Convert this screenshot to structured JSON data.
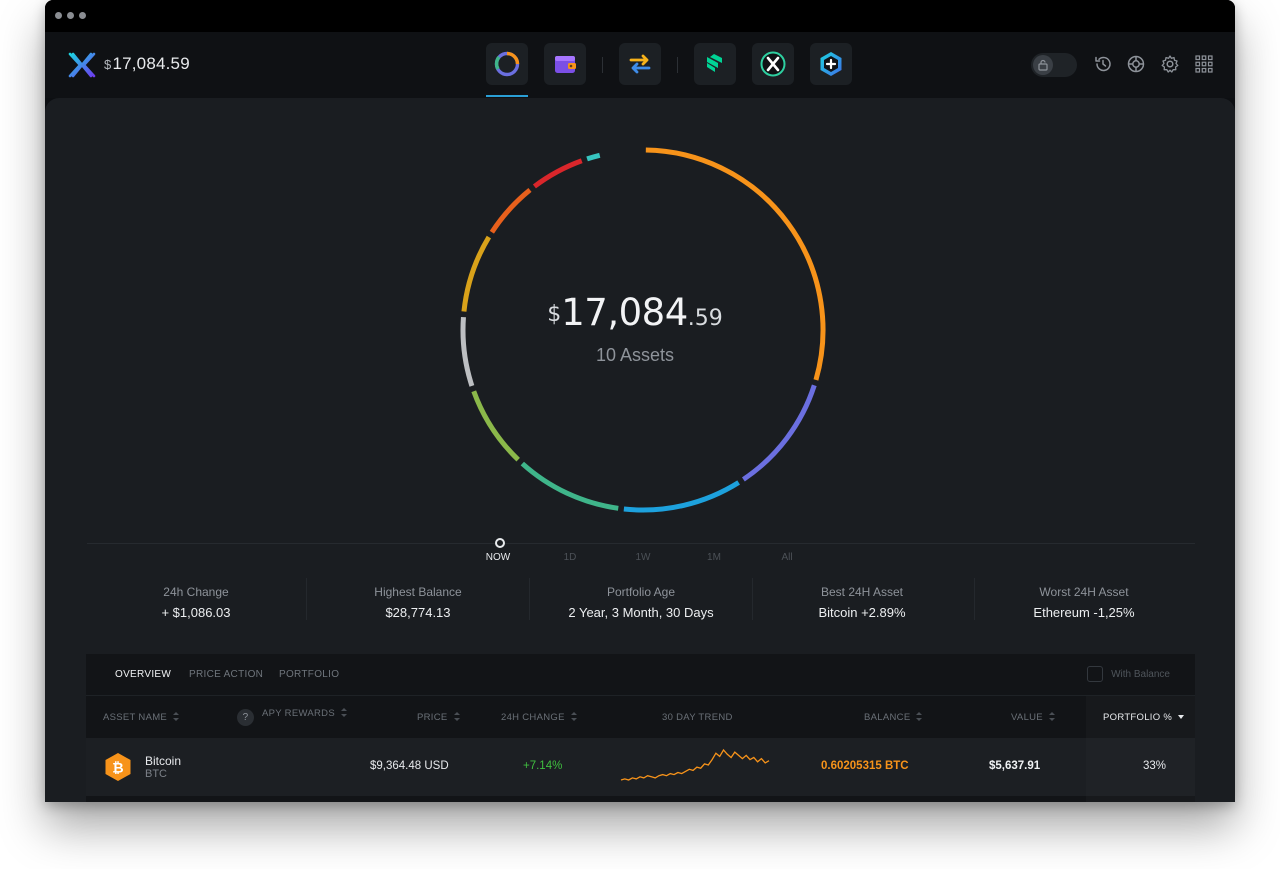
{
  "app": {
    "top_balance_symbol": "$",
    "top_balance_value": "17,084.59"
  },
  "nav": {
    "apps": [
      {
        "name": "portfolio",
        "active": true
      },
      {
        "name": "wallet",
        "active": false
      },
      {
        "name": "exchange",
        "active": false
      },
      {
        "name": "compound",
        "active": false
      },
      {
        "name": "exodus-x",
        "active": false
      },
      {
        "name": "add-app",
        "active": false
      }
    ],
    "right_icons": [
      "lock-icon",
      "history-icon",
      "help-icon",
      "settings-icon",
      "apps-grid-icon"
    ]
  },
  "portfolio_summary": {
    "symbol": "$",
    "value_int": "17,084",
    "value_dec": ".59",
    "assets_label": "10 Assets",
    "ring_colors": [
      "#f7931a",
      "#6b6fe0",
      "#1da1dd",
      "#3fb58a",
      "#8bb84a",
      "#bdbfc2",
      "#d9a21a",
      "#e8601c",
      "#d9262b",
      "#37c5c0"
    ]
  },
  "timeline": {
    "labels": [
      "NOW",
      "1D",
      "1W",
      "1M",
      "All"
    ],
    "active_index": 0
  },
  "stats": [
    {
      "label": "24h Change",
      "value": "+ $1,086.03"
    },
    {
      "label": "Highest Balance",
      "value": "$28,774.13"
    },
    {
      "label": "Portfolio Age",
      "value": "2 Year, 3 Month, 30 Days"
    },
    {
      "label": "Best 24H Asset",
      "value": "Bitcoin +2.89%"
    },
    {
      "label": "Worst 24H Asset",
      "value": "Ethereum -1,25%"
    }
  ],
  "table": {
    "tabs": [
      "OVERVIEW",
      "PRICE ACTION",
      "PORTFOLIO"
    ],
    "active_tab": 0,
    "with_balance_label": "With Balance",
    "columns": {
      "asset_name": "ASSET NAME",
      "help": "?",
      "apy": "APY REWARDS",
      "price": "PRICE",
      "change": "24H CHANGE",
      "trend": "30 DAY TREND",
      "balance": "BALANCE",
      "value": "VALUE",
      "portfolio": "PORTFOLIO %"
    },
    "rows": [
      {
        "name": "Bitcoin",
        "ticker": "BTC",
        "icon": "bitcoin-icon",
        "price": "$9,364.48 USD",
        "change": "+7.14%",
        "change_color": "#3fbf3f",
        "balance": "0.60205315 BTC",
        "balance_color": "#f7931a",
        "value": "$5,637.91",
        "portfolio": "33%",
        "trend": [
          8,
          9,
          8,
          10,
          9,
          11,
          10,
          12,
          11,
          10,
          12,
          13,
          12,
          14,
          13,
          15,
          14,
          16,
          18,
          17,
          20,
          19,
          23,
          22,
          27,
          33,
          30,
          36,
          32,
          29,
          34,
          31,
          28,
          31,
          27,
          29,
          25,
          28,
          24,
          26
        ]
      }
    ]
  }
}
